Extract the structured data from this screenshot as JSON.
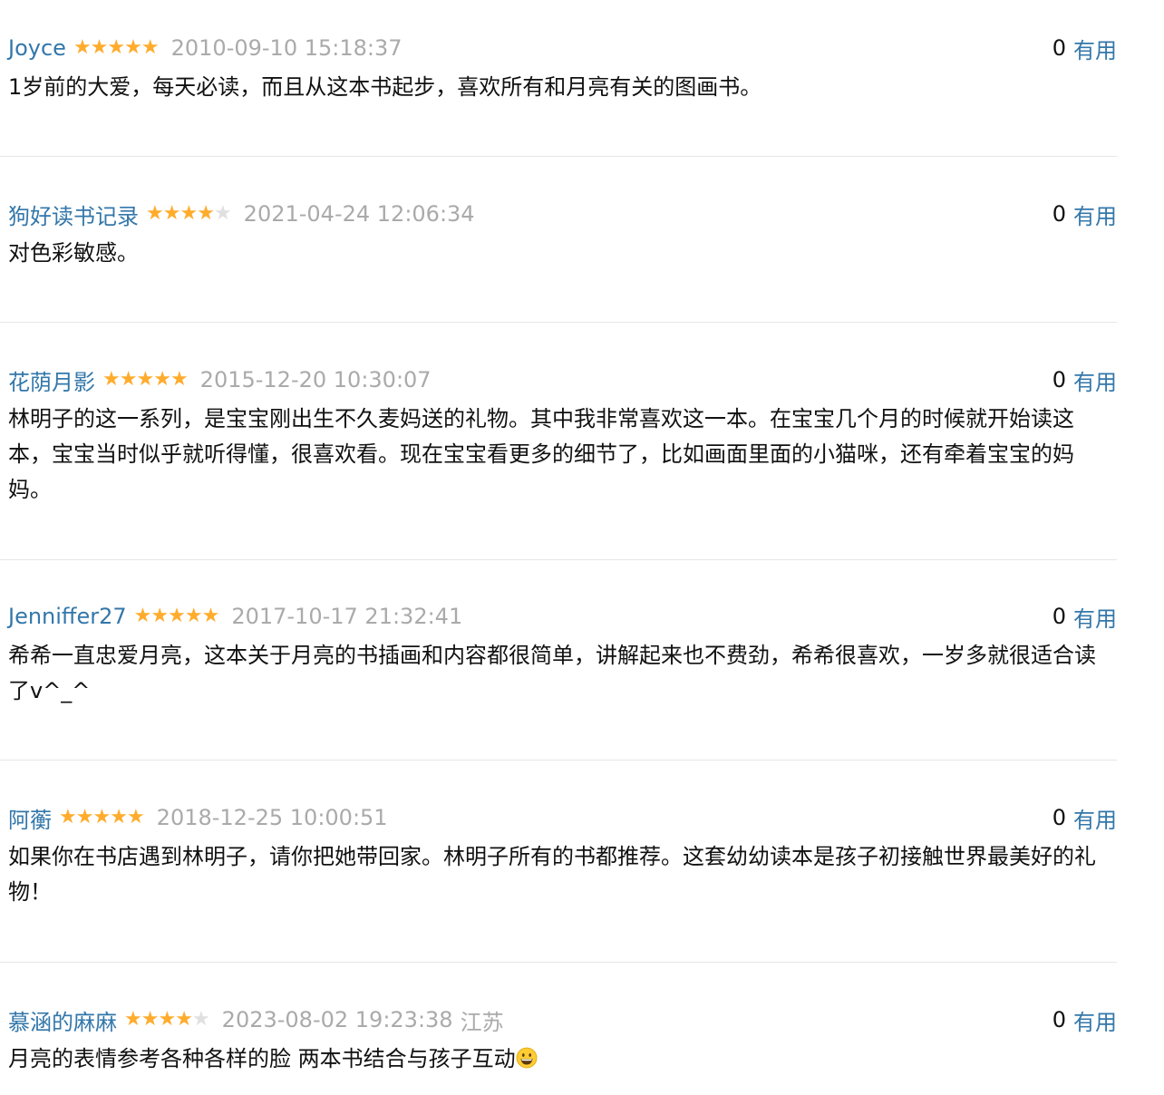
{
  "comments": [
    {
      "user": "Joyce",
      "rating": 5,
      "time": "2010-09-10 15:18:37",
      "location": "",
      "votes": "0",
      "useful_label": "有用",
      "content": "1岁前的大爱，每天必读，而且从这本书起步，喜欢所有和月亮有关的图画书。"
    },
    {
      "user": "狗好读书记录",
      "rating": 4,
      "time": "2021-04-24 12:06:34",
      "location": "",
      "votes": "0",
      "useful_label": "有用",
      "content": "对色彩敏感。"
    },
    {
      "user": "花荫月影",
      "rating": 5,
      "time": "2015-12-20 10:30:07",
      "location": "",
      "votes": "0",
      "useful_label": "有用",
      "content": "林明子的这一系列，是宝宝刚出生不久麦妈送的礼物。其中我非常喜欢这一本。在宝宝几个月的时候就开始读这本，宝宝当时似乎就听得懂，很喜欢看。现在宝宝看更多的细节了，比如画面里面的小猫咪，还有牵着宝宝的妈妈。"
    },
    {
      "user": "Jenniffer27",
      "rating": 5,
      "time": "2017-10-17 21:32:41",
      "location": "",
      "votes": "0",
      "useful_label": "有用",
      "content": "希希一直忠爱月亮，这本关于月亮的书插画和内容都很简单，讲解起来也不费劲，希希很喜欢，一岁多就很适合读了v^_^"
    },
    {
      "user": "阿蘅",
      "rating": 5,
      "time": "2018-12-25 10:00:51",
      "location": "",
      "votes": "0",
      "useful_label": "有用",
      "content": "如果你在书店遇到林明子，请你把她带回家。林明子所有的书都推荐。这套幼幼读本是孩子初接触世界最美好的礼物！"
    },
    {
      "user": "慕涵的麻麻",
      "rating": 4,
      "time": "2023-08-02 19:23:38",
      "location": "江苏",
      "votes": "0",
      "useful_label": "有用",
      "content": "月亮的表情参考各种各样的脸 两本书结合与孩子互动",
      "trailing_icon": "grinning-face-emoji-icon"
    }
  ],
  "colors": {
    "link": "#3377aa",
    "star": "#ffac2d",
    "star_empty": "#e0e0e0",
    "meta": "#aaaaaa",
    "text": "#111111",
    "divider": "#e6e6e6"
  }
}
